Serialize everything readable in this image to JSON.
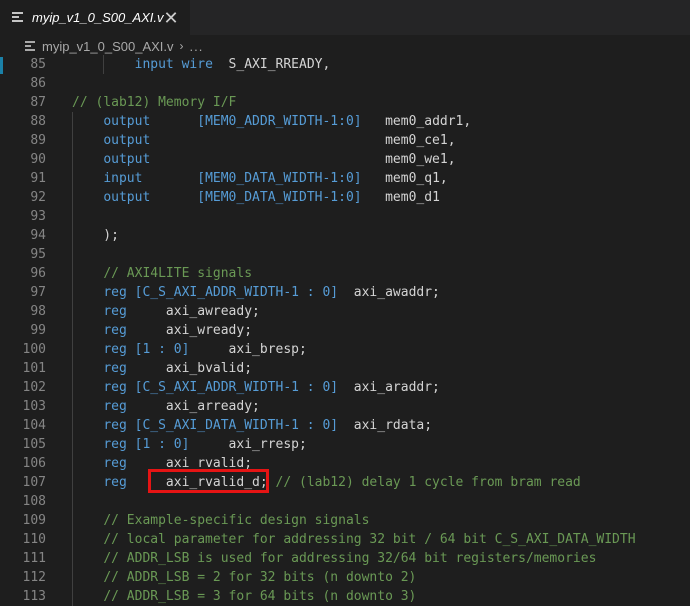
{
  "tab": {
    "title": "myip_v1_0_S00_AXI.v",
    "close_glyph": "✕",
    "icon": "verilog-file-icon"
  },
  "breadcrumb": {
    "file": "myip_v1_0_S00_AXI.v",
    "separator": "›",
    "more": "..."
  },
  "colors": {
    "keyword": "#569cd6",
    "comment": "#6a9955",
    "text": "#d4d4d4",
    "line_number": "#858585",
    "highlight_box": "#e51414"
  },
  "lines": [
    {
      "n": "85",
      "parts": [
        {
          "t": "        "
        },
        {
          "t": "input wire",
          "c": "kw"
        },
        {
          "t": "  S_AXI_RREADY,"
        }
      ]
    },
    {
      "n": "86",
      "parts": []
    },
    {
      "n": "87",
      "parts": [
        {
          "t": "// (lab12) Memory I/F",
          "c": "cm"
        }
      ]
    },
    {
      "n": "88",
      "parts": [
        {
          "t": "    "
        },
        {
          "t": "output",
          "c": "kw"
        },
        {
          "t": "      "
        },
        {
          "t": "[MEM0_ADDR_WIDTH-1:0]",
          "c": "br"
        },
        {
          "t": "   mem0_addr1,"
        }
      ]
    },
    {
      "n": "89",
      "parts": [
        {
          "t": "    "
        },
        {
          "t": "output",
          "c": "kw"
        },
        {
          "t": "                              mem0_ce1,"
        }
      ]
    },
    {
      "n": "90",
      "parts": [
        {
          "t": "    "
        },
        {
          "t": "output",
          "c": "kw"
        },
        {
          "t": "                              mem0_we1,"
        }
      ]
    },
    {
      "n": "91",
      "parts": [
        {
          "t": "    "
        },
        {
          "t": "input",
          "c": "kw"
        },
        {
          "t": "       "
        },
        {
          "t": "[MEM0_DATA_WIDTH-1:0]",
          "c": "br"
        },
        {
          "t": "   mem0_q1,"
        }
      ]
    },
    {
      "n": "92",
      "parts": [
        {
          "t": "    "
        },
        {
          "t": "output",
          "c": "kw"
        },
        {
          "t": "      "
        },
        {
          "t": "[MEM0_DATA_WIDTH-1:0]",
          "c": "br"
        },
        {
          "t": "   mem0_d1"
        }
      ]
    },
    {
      "n": "93",
      "parts": []
    },
    {
      "n": "94",
      "parts": [
        {
          "t": "    );"
        }
      ]
    },
    {
      "n": "95",
      "parts": []
    },
    {
      "n": "96",
      "parts": [
        {
          "t": "    "
        },
        {
          "t": "// AXI4LITE signals",
          "c": "cm"
        }
      ]
    },
    {
      "n": "97",
      "parts": [
        {
          "t": "    "
        },
        {
          "t": "reg",
          "c": "kw"
        },
        {
          "t": " "
        },
        {
          "t": "[C_S_AXI_ADDR_WIDTH-1 : 0]",
          "c": "br"
        },
        {
          "t": "  axi_awaddr;"
        }
      ]
    },
    {
      "n": "98",
      "parts": [
        {
          "t": "    "
        },
        {
          "t": "reg",
          "c": "kw"
        },
        {
          "t": "     axi_awready;"
        }
      ]
    },
    {
      "n": "99",
      "parts": [
        {
          "t": "    "
        },
        {
          "t": "reg",
          "c": "kw"
        },
        {
          "t": "     axi_wready;"
        }
      ]
    },
    {
      "n": "100",
      "parts": [
        {
          "t": "    "
        },
        {
          "t": "reg",
          "c": "kw"
        },
        {
          "t": " "
        },
        {
          "t": "[1 : 0]",
          "c": "br"
        },
        {
          "t": "     axi_bresp;"
        }
      ]
    },
    {
      "n": "101",
      "parts": [
        {
          "t": "    "
        },
        {
          "t": "reg",
          "c": "kw"
        },
        {
          "t": "     axi_bvalid;"
        }
      ]
    },
    {
      "n": "102",
      "parts": [
        {
          "t": "    "
        },
        {
          "t": "reg",
          "c": "kw"
        },
        {
          "t": " "
        },
        {
          "t": "[C_S_AXI_ADDR_WIDTH-1 : 0]",
          "c": "br"
        },
        {
          "t": "  axi_araddr;"
        }
      ]
    },
    {
      "n": "103",
      "parts": [
        {
          "t": "    "
        },
        {
          "t": "reg",
          "c": "kw"
        },
        {
          "t": "     axi_arready;"
        }
      ]
    },
    {
      "n": "104",
      "parts": [
        {
          "t": "    "
        },
        {
          "t": "reg",
          "c": "kw"
        },
        {
          "t": " "
        },
        {
          "t": "[C_S_AXI_DATA_WIDTH-1 : 0]",
          "c": "br"
        },
        {
          "t": "  axi_rdata;"
        }
      ]
    },
    {
      "n": "105",
      "parts": [
        {
          "t": "    "
        },
        {
          "t": "reg",
          "c": "kw"
        },
        {
          "t": " "
        },
        {
          "t": "[1 : 0]",
          "c": "br"
        },
        {
          "t": "     axi_rresp;"
        }
      ]
    },
    {
      "n": "106",
      "parts": [
        {
          "t": "    "
        },
        {
          "t": "reg",
          "c": "kw"
        },
        {
          "t": "     axi_rvalid;"
        }
      ]
    },
    {
      "n": "107",
      "parts": [
        {
          "t": "    "
        },
        {
          "t": "reg",
          "c": "kw"
        },
        {
          "t": "     axi_rvalid_d; "
        },
        {
          "t": "// (lab12) delay 1 cycle from bram read",
          "c": "cm"
        }
      ]
    },
    {
      "n": "108",
      "parts": []
    },
    {
      "n": "109",
      "parts": [
        {
          "t": "    "
        },
        {
          "t": "// Example-specific design signals",
          "c": "cm"
        }
      ]
    },
    {
      "n": "110",
      "parts": [
        {
          "t": "    "
        },
        {
          "t": "// local parameter for addressing 32 bit / 64 bit C_S_AXI_DATA_WIDTH",
          "c": "cm"
        }
      ]
    },
    {
      "n": "111",
      "parts": [
        {
          "t": "    "
        },
        {
          "t": "// ADDR_LSB is used for addressing 32/64 bit registers/memories",
          "c": "cm"
        }
      ]
    },
    {
      "n": "112",
      "parts": [
        {
          "t": "    "
        },
        {
          "t": "// ADDR_LSB = 2 for 32 bits (n downto 2)",
          "c": "cm"
        }
      ]
    },
    {
      "n": "113",
      "parts": [
        {
          "t": "    "
        },
        {
          "t": "// ADDR_LSB = 3 for 64 bits (n downto 3)",
          "c": "cm"
        }
      ]
    }
  ]
}
